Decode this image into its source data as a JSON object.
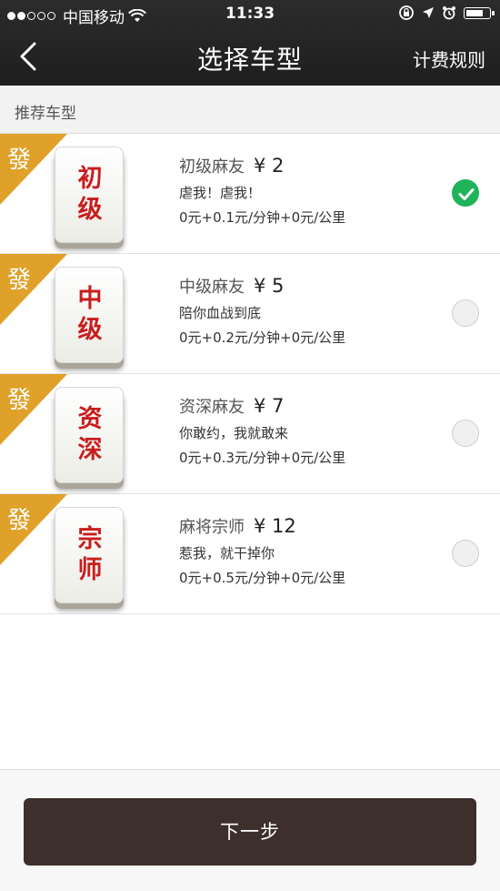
{
  "status_bar": {
    "carrier": "中国移动",
    "time": "11:33",
    "signal_dots_filled": 2,
    "signal_dots_total": 5,
    "battery_level": 0.8
  },
  "nav": {
    "title": "选择车型",
    "right_link": "计费规则"
  },
  "section": {
    "title": "推荐车型"
  },
  "colors": {
    "header_bg": "#262626",
    "corner_gold": "#e0a12a",
    "tile_red": "#c81d1d",
    "check_green": "#1fb35a",
    "button_bg": "#3d2f2b"
  },
  "options": [
    {
      "corner": "發",
      "tile_line1": "初",
      "tile_line2": "级",
      "name": "初级麻友",
      "price": "¥ 2",
      "desc": "虐我！虐我！",
      "rate": "0元+0.1元/分钟+0元/公里",
      "selected": true
    },
    {
      "corner": "發",
      "tile_line1": "中",
      "tile_line2": "级",
      "name": "中级麻友",
      "price": "¥ 5",
      "desc": "陪你血战到底",
      "rate": "0元+0.2元/分钟+0元/公里",
      "selected": false
    },
    {
      "corner": "發",
      "tile_line1": "资",
      "tile_line2": "深",
      "name": "资深麻友",
      "price": "¥ 7",
      "desc": "你敢约，我就敢来",
      "rate": "0元+0.3元/分钟+0元/公里",
      "selected": false
    },
    {
      "corner": "發",
      "tile_line1": "宗",
      "tile_line2": "师",
      "name": "麻将宗师",
      "price": "¥ 12",
      "desc": "惹我，就干掉你",
      "rate": "0元+0.5元/分钟+0元/公里",
      "selected": false
    }
  ],
  "bottom": {
    "next_label": "下一步"
  }
}
